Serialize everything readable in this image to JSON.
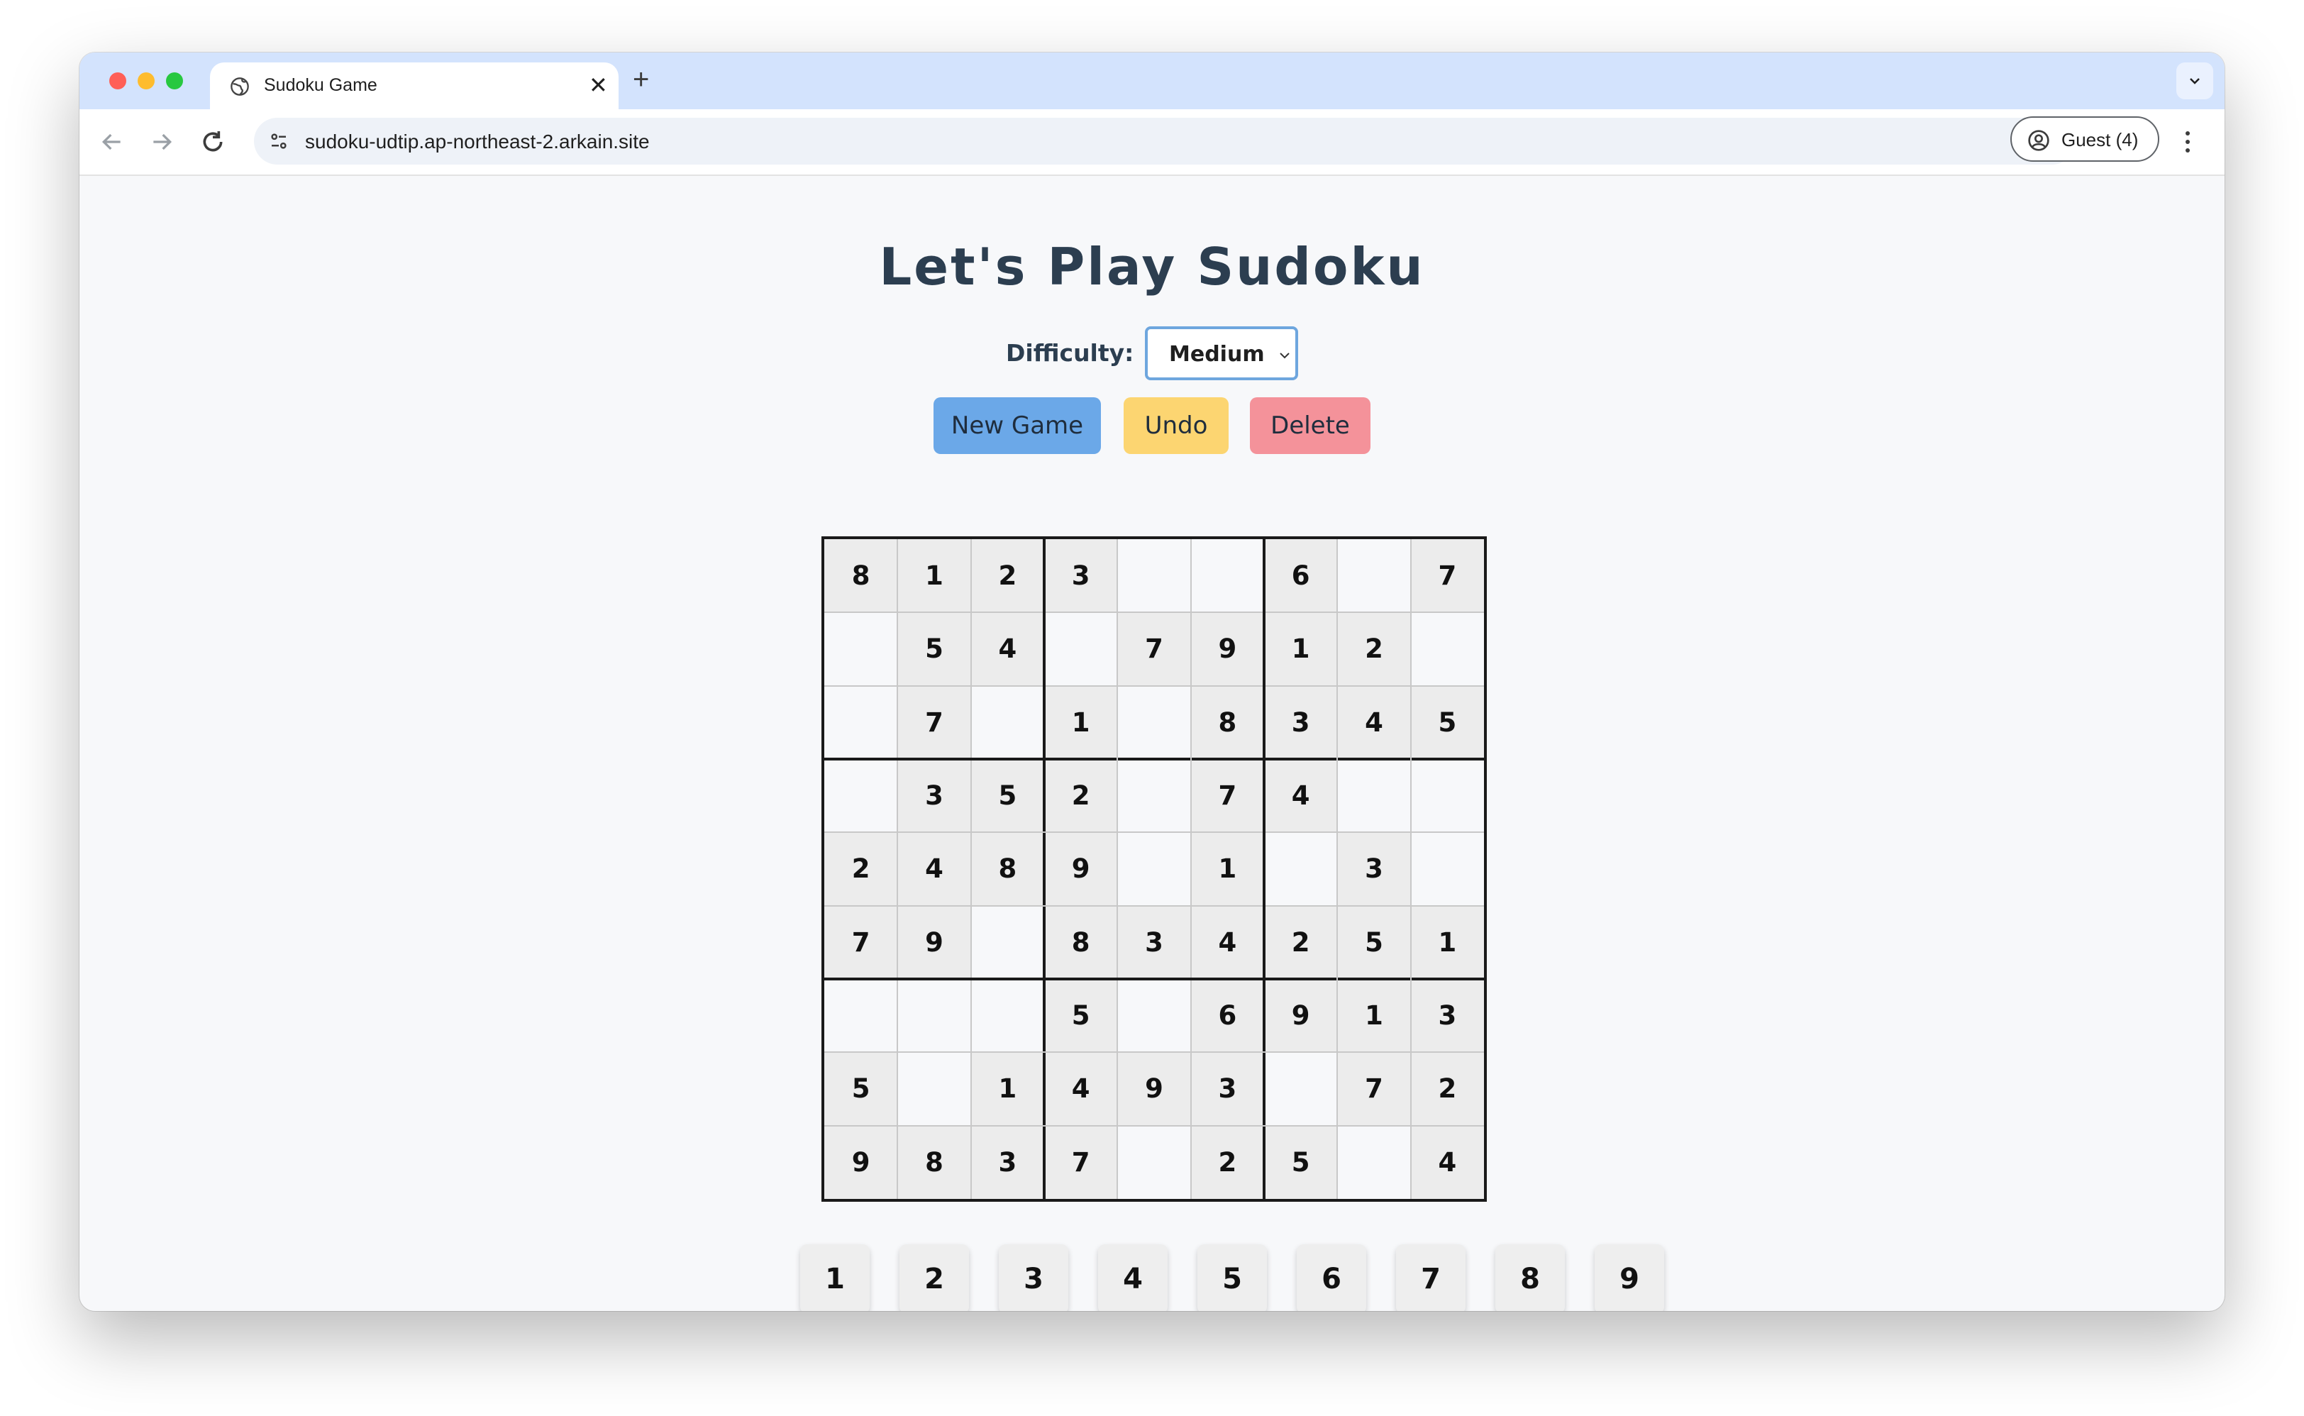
{
  "browser": {
    "tab_title": "Sudoku Game",
    "tab_close": "✕",
    "new_tab": "+",
    "url": "sudoku-udtip.ap-northeast-2.arkain.site",
    "profile_label": "Guest (4)"
  },
  "page": {
    "title": "Let's Play Sudoku",
    "difficulty_label": "Difficulty:",
    "difficulty_value": "Medium",
    "buttons": {
      "new_game": "New Game",
      "undo": "Undo",
      "delete": "Delete"
    }
  },
  "board": [
    [
      "8",
      "1",
      "2",
      "3",
      "",
      "",
      "6",
      "",
      "7"
    ],
    [
      "",
      "5",
      "4",
      "",
      "7",
      "9",
      "1",
      "2",
      ""
    ],
    [
      "",
      "7",
      "",
      "1",
      "",
      "8",
      "3",
      "4",
      "5"
    ],
    [
      "",
      "3",
      "5",
      "2",
      "",
      "7",
      "4",
      "",
      ""
    ],
    [
      "2",
      "4",
      "8",
      "9",
      "",
      "1",
      "",
      "3",
      ""
    ],
    [
      "7",
      "9",
      "",
      "8",
      "3",
      "4",
      "2",
      "5",
      "1"
    ],
    [
      "",
      "",
      "",
      "5",
      "",
      "6",
      "9",
      "1",
      "3"
    ],
    [
      "5",
      "",
      "1",
      "4",
      "9",
      "3",
      "",
      "7",
      "2"
    ],
    [
      "9",
      "8",
      "3",
      "7",
      "",
      "2",
      "5",
      "",
      "4"
    ]
  ],
  "numpad": [
    "1",
    "2",
    "3",
    "4",
    "5",
    "6",
    "7",
    "8",
    "9"
  ],
  "colors": {
    "title": "#2c3e50",
    "new_game": "#6ba8e8",
    "undo": "#fcd571",
    "delete": "#f4929a",
    "filled_cell": "#ececec"
  }
}
